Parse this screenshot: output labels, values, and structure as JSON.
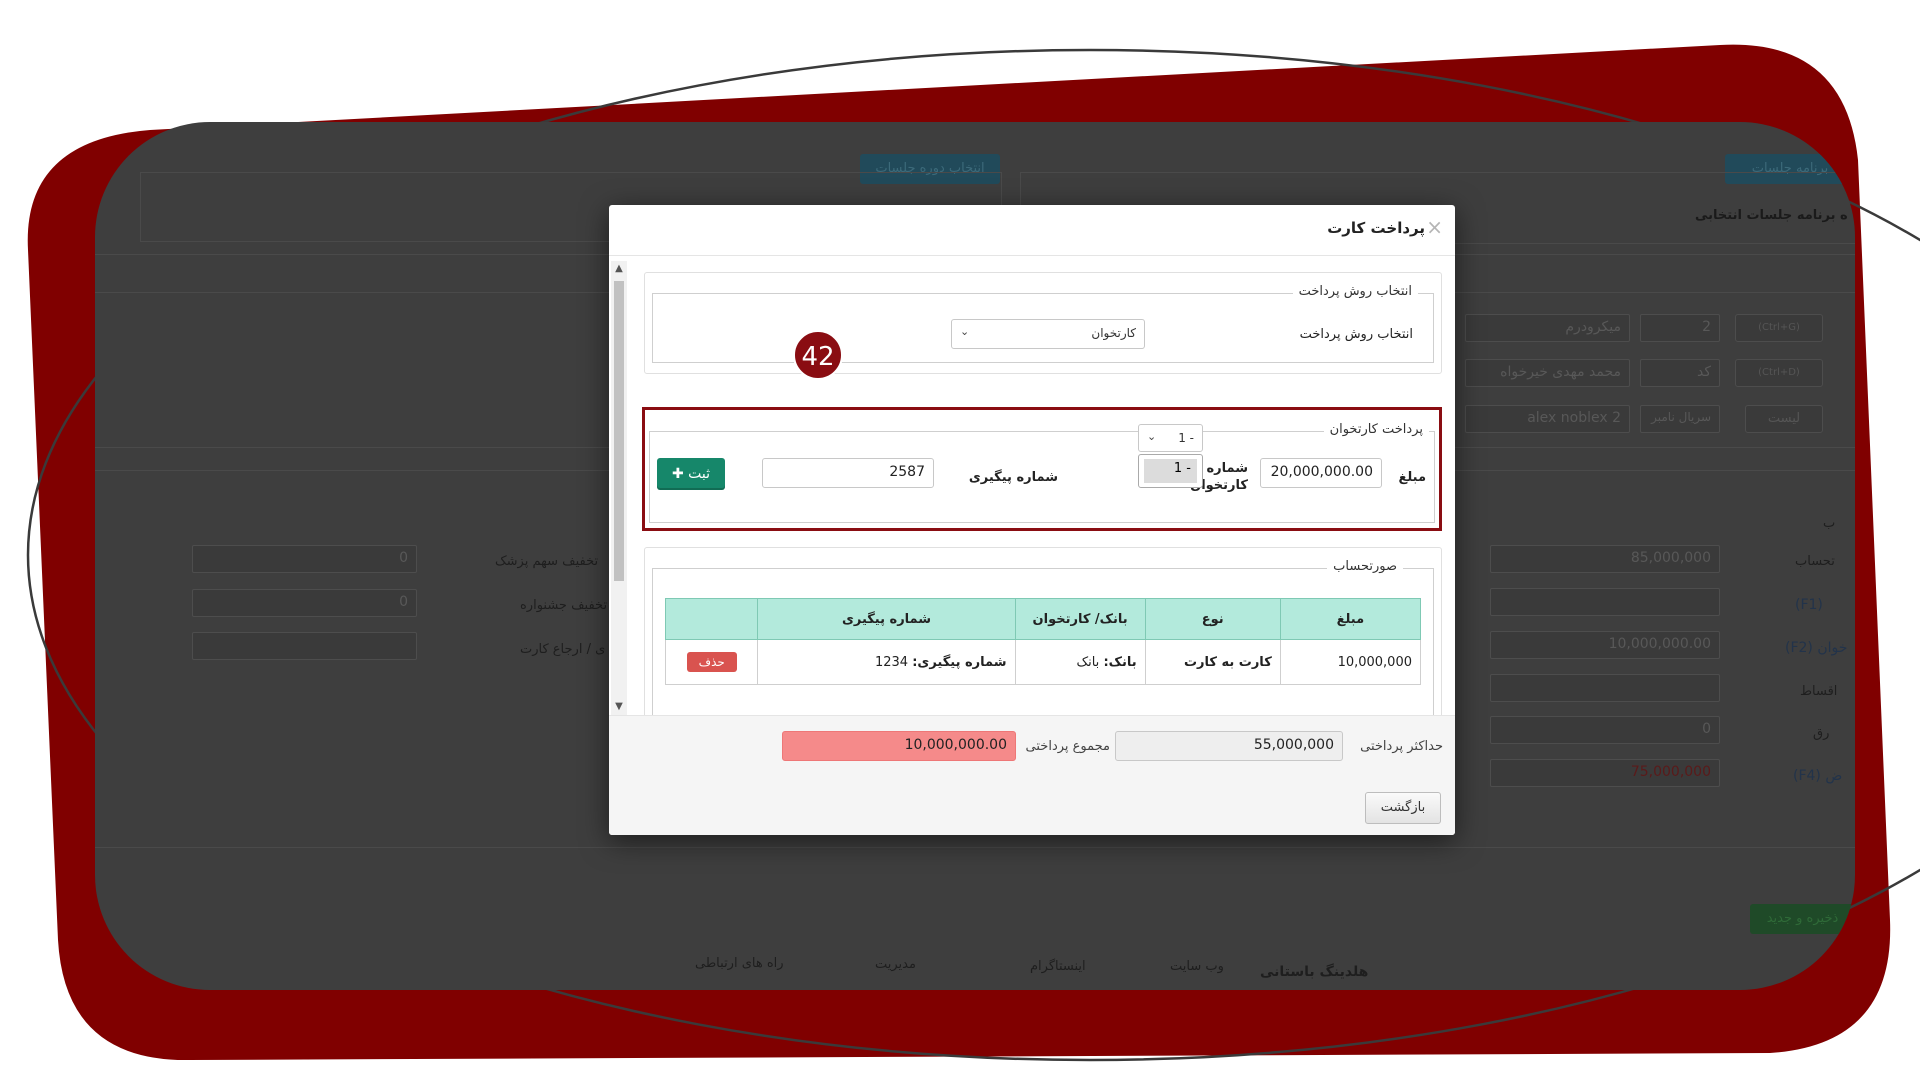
{
  "modal": {
    "title": "پرداخت کارت",
    "close_icon": "×",
    "method_legend": "انتخاب روش پرداخت",
    "method_label": "انتخاب روش پرداخت",
    "method_value": "کارتخوان",
    "pos_legend": "پرداخت کارتخوان",
    "amount_label": "مبلغ",
    "amount_value": "20,000,000.00",
    "terminal_label": "شماره کارتخوان",
    "terminal_value": "1 -",
    "terminal_option": "1 -",
    "tracking_label": "شماره پیگیری",
    "tracking_value": "2587",
    "submit_label": "ثبت",
    "statement_legend": "صورتحساب",
    "table": {
      "headers": [
        "مبلغ",
        "نوع",
        "بانک/ کارتخوان",
        "شماره پیگیری",
        ""
      ],
      "rows": [
        {
          "amount": "10,000,000",
          "type": "کارت به کارت",
          "bank_label": "بانک:",
          "bank_value": "بانک",
          "tracking_label": "شماره پیگیری:",
          "tracking_value": "1234",
          "delete_label": "حذف"
        }
      ]
    },
    "max_payment_label": "حداکثر پرداختی",
    "max_payment_value": "55,000,000",
    "total_payment_label": "مجموع پرداختی",
    "total_payment_value": "10,000,000.00",
    "back_label": "بازگشت"
  },
  "annotation": {
    "step_number": "42",
    "highlight_color": "#8a0d12"
  },
  "background": {
    "top_button_left": "انتخاب دوره جلسات",
    "top_button_right": "برنامه جلسات",
    "session_title": "ه برنامه جلسات انتخابی",
    "row1": {
      "shortcut": "(Ctrl+G)",
      "num": "2",
      "name": "میکرودرم"
    },
    "row2": {
      "shortcut": "(Ctrl+D)",
      "code": "کد",
      "name": "محمد مهدی خیرخواه"
    },
    "row3": {
      "shortcut": "لیست",
      "serial": "سریال نامبر",
      "name": "alex noblex 2"
    },
    "section_label": "ب",
    "left_labels": [
      "تخفیف سهم پزشک",
      "تخفیف جشنواره",
      "ی / ارجاع کارت"
    ],
    "left_values": [
      "0",
      "0",
      ""
    ],
    "right_labels": [
      "تحساب",
      "(F1)",
      "(F2) خوان",
      "اقساط",
      "رق",
      "(F4) ض"
    ],
    "right_values": [
      "85,000,000",
      "",
      "10,000,000.00",
      "",
      "0",
      "75,000,000"
    ],
    "save_button": "ذخیره و جدید",
    "footer": {
      "brand": "هلدینگ باستانی",
      "links": [
        "وب سایت",
        "اینستاگرام",
        "مدیریت",
        "راه های ارتباطی"
      ]
    }
  },
  "colors": {
    "frame": "#800000",
    "accent_green": "#16876a",
    "header_teal": "#b3eadc",
    "total_pink": "#f58a8a"
  }
}
